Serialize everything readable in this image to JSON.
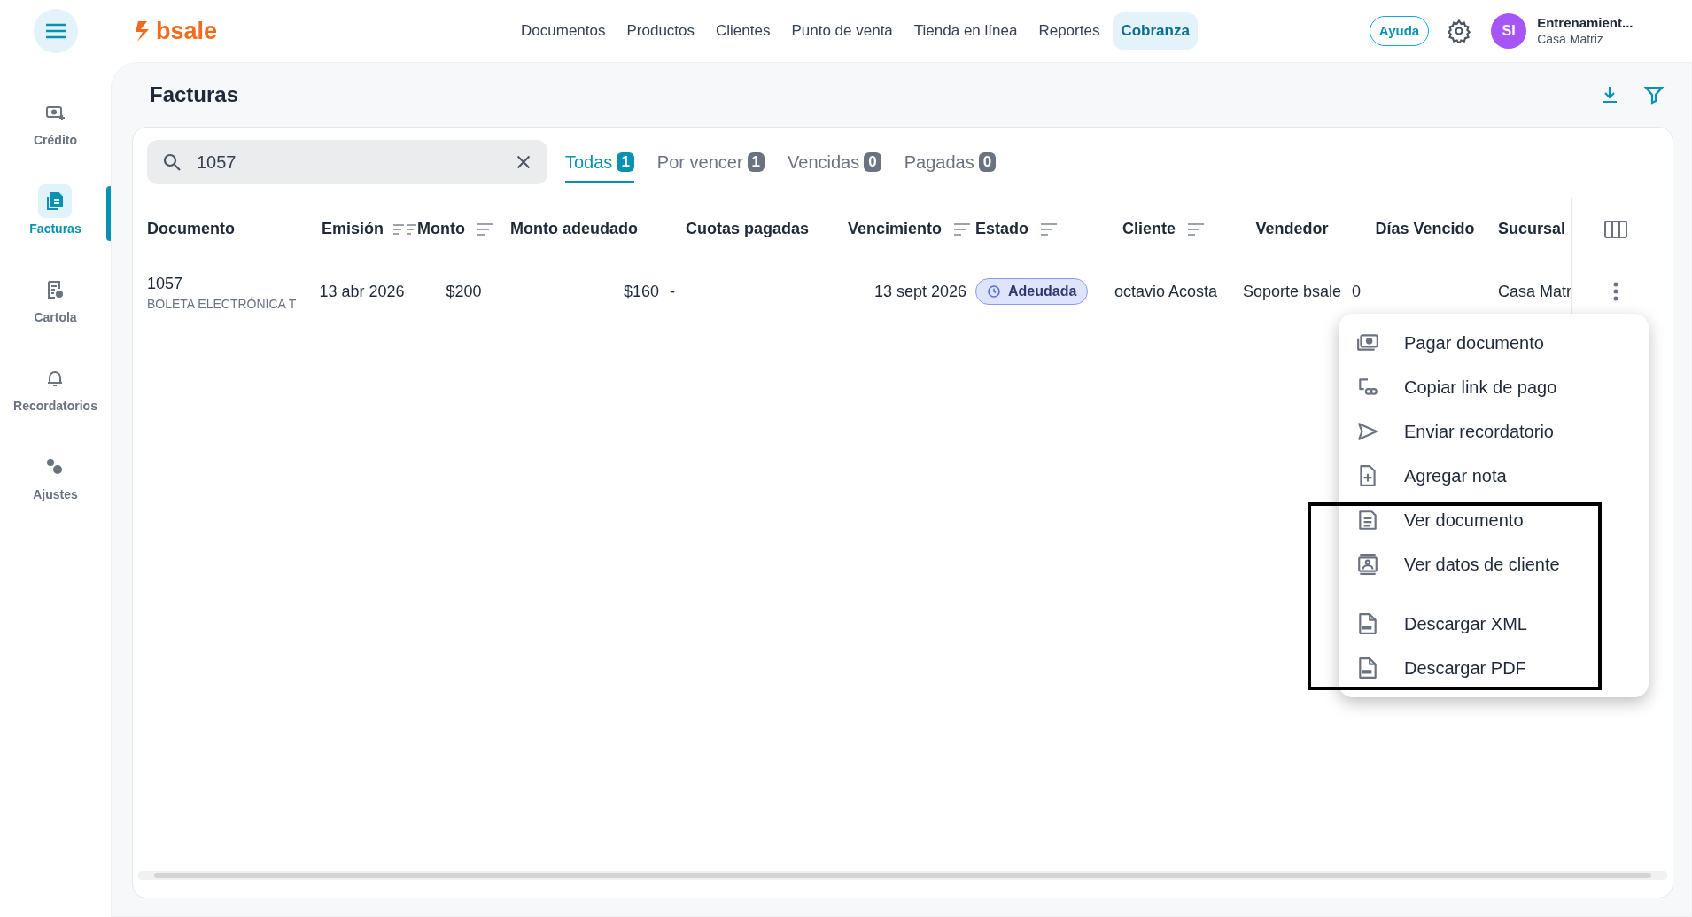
{
  "header": {
    "logo": "bsale",
    "nav": [
      {
        "label": "Documentos",
        "selected": false
      },
      {
        "label": "Productos",
        "selected": false
      },
      {
        "label": "Clientes",
        "selected": false
      },
      {
        "label": "Punto de venta",
        "selected": false
      },
      {
        "label": "Tienda en línea",
        "selected": false
      },
      {
        "label": "Reportes",
        "selected": false
      },
      {
        "label": "Cobranza",
        "selected": true
      }
    ],
    "help": "Ayuda",
    "user": {
      "initials": "SI",
      "name": "Entrenamient...",
      "branch": "Casa Matriz"
    }
  },
  "sidebar": {
    "items": [
      {
        "label": "Crédito",
        "selected": false
      },
      {
        "label": "Facturas",
        "selected": true
      },
      {
        "label": "Cartola",
        "selected": false
      },
      {
        "label": "Recordatorios",
        "selected": false
      },
      {
        "label": "Ajustes",
        "selected": false
      }
    ]
  },
  "page": {
    "title": "Facturas"
  },
  "search": {
    "value": "1057"
  },
  "tabs": [
    {
      "label": "Todas",
      "count": "1",
      "selected": true
    },
    {
      "label": "Por vencer",
      "count": "1",
      "selected": false
    },
    {
      "label": "Vencidas",
      "count": "0",
      "selected": false
    },
    {
      "label": "Pagadas",
      "count": "0",
      "selected": false
    }
  ],
  "table": {
    "columns": [
      {
        "label": "Documento",
        "sortable": false
      },
      {
        "label": "Emisión",
        "sortable": true
      },
      {
        "label": "Monto",
        "sortable": true
      },
      {
        "label": "Monto adeudado",
        "sortable": false
      },
      {
        "label": "Cuotas pagadas",
        "sortable": false
      },
      {
        "label": "Vencimiento",
        "sortable": true
      },
      {
        "label": "Estado",
        "sortable": true
      },
      {
        "label": "Cliente",
        "sortable": true
      },
      {
        "label": "Vendedor",
        "sortable": false
      },
      {
        "label": "Días Vencido",
        "sortable": false
      },
      {
        "label": "Sucursal",
        "sortable": false
      }
    ],
    "rows": [
      {
        "number": "1057",
        "doc_type": "BOLETA ELECTRÓNICA T",
        "issued": "13 abr 2026",
        "amount": "$200",
        "owed": "$160",
        "installments": "-",
        "due": "13 sept 2026",
        "status": "Adeudada",
        "client": "octavio Acosta",
        "seller": "Soporte bsale",
        "days_overdue": "0",
        "branch": "Casa Matr"
      }
    ]
  },
  "row_menu": {
    "items": [
      {
        "label": "Pagar documento",
        "divider_before": false
      },
      {
        "label": "Copiar link de pago",
        "divider_before": false
      },
      {
        "label": "Enviar recordatorio",
        "divider_before": false
      },
      {
        "label": "Agregar nota",
        "divider_before": false
      },
      {
        "label": "Ver documento",
        "divider_before": false
      },
      {
        "label": "Ver datos de cliente",
        "divider_before": false
      },
      {
        "label": "Descargar XML",
        "divider_before": true
      },
      {
        "label": "Descargar PDF",
        "divider_before": false
      }
    ]
  }
}
